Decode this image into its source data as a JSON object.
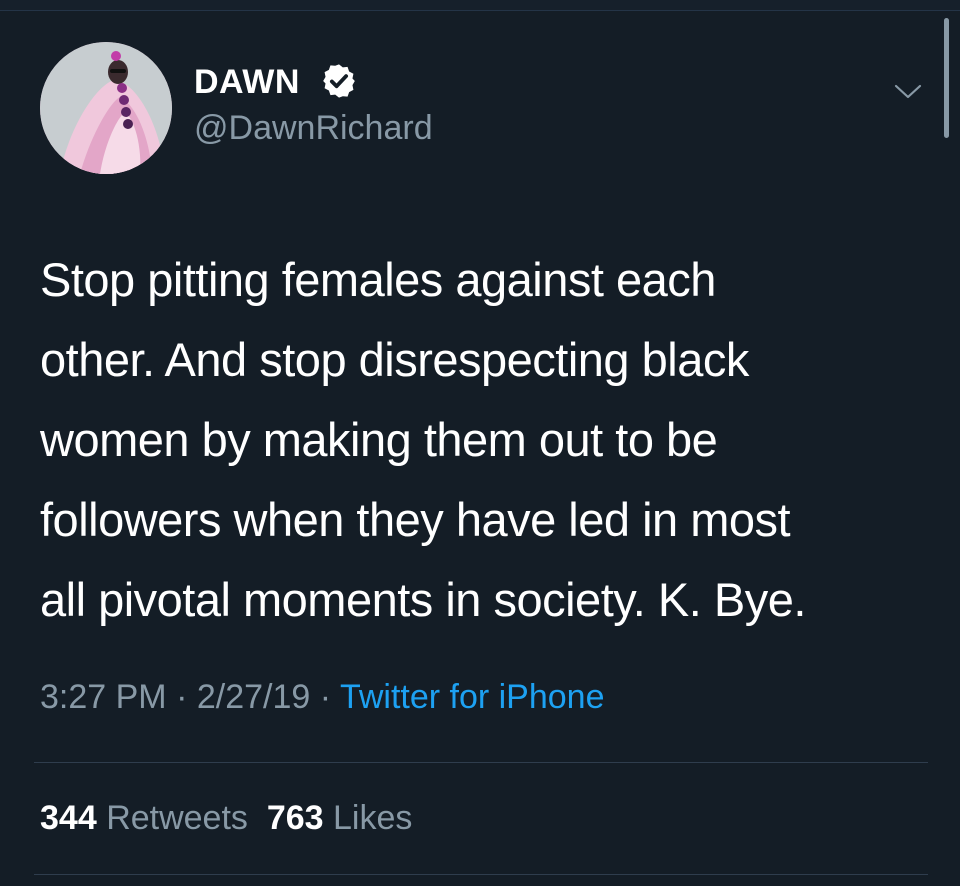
{
  "author": {
    "display_name": "DAWN",
    "handle": "@DawnRichard",
    "verified": true
  },
  "tweet": {
    "text": "Stop pitting females against each\nother. And stop disrespecting black\nwomen by making them out to be\nfollowers when they have led in most\nall pivotal moments in society. K. Bye.",
    "time": "3:27 PM",
    "date": "2/27/19",
    "separator": "·",
    "source": "Twitter for iPhone"
  },
  "stats": {
    "retweets_count": "344",
    "retweets_label": "Retweets",
    "likes_count": "763",
    "likes_label": "Likes"
  },
  "icons": {
    "verified": "verified-badge-icon",
    "caret": "chevron-down-icon"
  },
  "colors": {
    "background": "#141d26",
    "secondary_text": "#8899a6",
    "link": "#1da1f2",
    "primary_text": "#ffffff"
  }
}
